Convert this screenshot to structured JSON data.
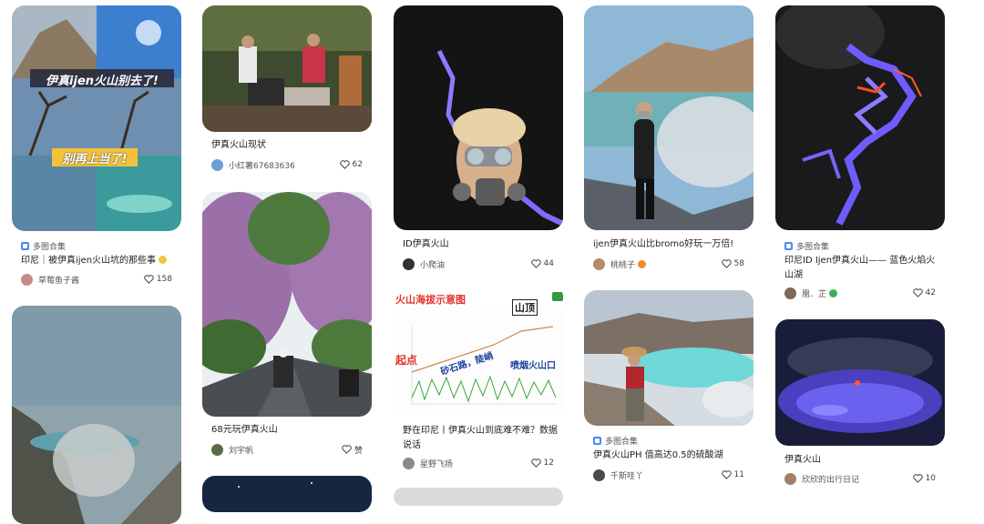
{
  "cards": {
    "c1": {
      "overlay1": "伊真ijen火山别去了!",
      "overlay2": "别再上当了!",
      "badge": "多图合集",
      "title": "印尼｜被伊真ijen火山坑的那些事",
      "author": "草莓鱼子酱",
      "likes": "158"
    },
    "c2": {
      "title": "伊真火山现状",
      "author": "小红薯67683636",
      "likes": "62"
    },
    "c3": {
      "title": "68元玩伊真火山",
      "author": "刘宇帆",
      "likes": "赞"
    },
    "c4": {
      "title": "ID伊真火山",
      "author": "小爬油",
      "likes": "44"
    },
    "c5": {
      "overlay_title": "火山海拔示意图",
      "overlay_peak": "山顶",
      "overlay_start": "起点",
      "overlay_gravel": "砂石路，陡峭",
      "overlay_side": "喷烟火山口",
      "title": "野在印尼丨伊真火山到底难不难？数据说话",
      "author": "星野飞扬",
      "likes": "12"
    },
    "c6": {
      "title": "ijen伊真火山比bromo好玩一万倍!",
      "author": "桃桃子",
      "likes": "58"
    },
    "c7": {
      "badge": "多图合集",
      "title": "伊真火山PH 值高达0.5的硫酸湖",
      "author": "千斯哇丫",
      "likes": "11"
    },
    "c8": {
      "badge": "多图合集",
      "title": "印尼ID Ijen伊真火山—— 蓝色火焰火山湖",
      "author": "凰．芷",
      "likes": "42"
    },
    "c9": {
      "title": "伊真火山",
      "author": "欣欣的出行日记",
      "likes": "10"
    }
  },
  "colors": {
    "badge_blue": "#4a8cf7",
    "text": "#222222",
    "muted": "#555555"
  },
  "icons": {
    "like": "heart-outline-icon",
    "badge": "album-icon"
  }
}
